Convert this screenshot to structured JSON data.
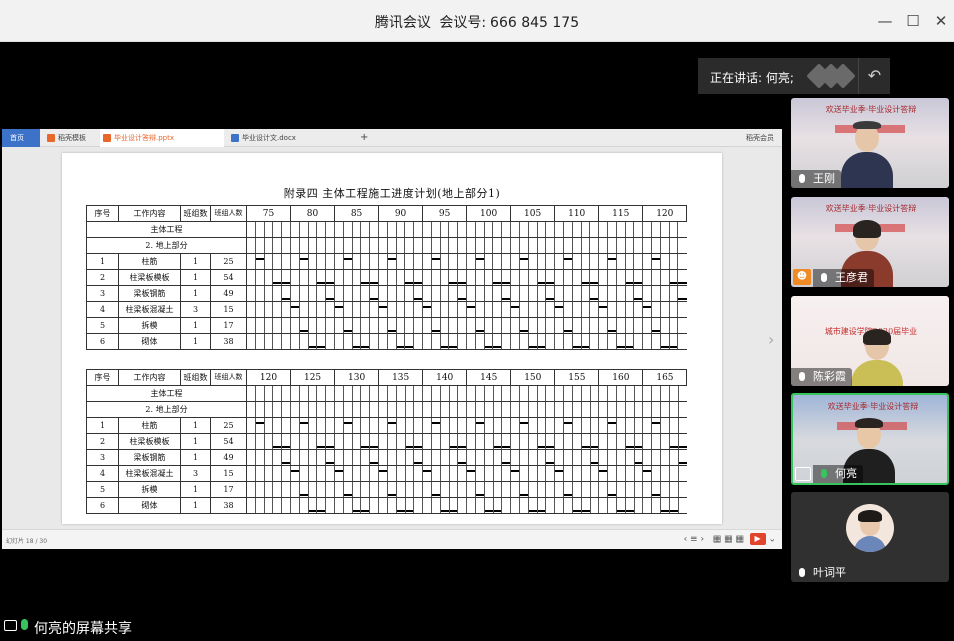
{
  "window": {
    "app_name": "腾讯会议",
    "meeting_id_label": "会议号:",
    "meeting_id": "666 845 175"
  },
  "speaking": {
    "label": "正在讲话: 何亮;"
  },
  "shared_screen": {
    "tabs": [
      {
        "label": "首页",
        "icon": "home-icon"
      },
      {
        "label": "稻壳模板",
        "icon": "docer-icon",
        "color": "#e8672c"
      },
      {
        "label": "毕业设计答辩.pptx",
        "icon": "ppt-icon",
        "color": "#e8672c"
      },
      {
        "label": "毕业设计文.docx",
        "icon": "word-icon",
        "color": "#3d72c9"
      }
    ],
    "tab_add": "+",
    "right_text": "稻壳会员",
    "status_left": "幻灯片 18 / 30",
    "document": {
      "title": "附录四  主体工程施工进度计划(地上部分1)",
      "headers": {
        "no": "序号",
        "content": "工作内容",
        "group": "班组数",
        "workers": "班组人数"
      },
      "section_main": "主体工程",
      "section_sub": "2. 地上部分",
      "rows": [
        {
          "no": "1",
          "content": "柱筋",
          "group": "1",
          "workers": "25"
        },
        {
          "no": "2",
          "content": "柱梁板模板",
          "group": "1",
          "workers": "54"
        },
        {
          "no": "3",
          "content": "梁板钢筋",
          "group": "1",
          "workers": "49"
        },
        {
          "no": "4",
          "content": "柱梁板混凝土",
          "group": "3",
          "workers": "15"
        },
        {
          "no": "5",
          "content": "拆模",
          "group": "1",
          "workers": "17"
        },
        {
          "no": "6",
          "content": "砌体",
          "group": "1",
          "workers": "38"
        }
      ],
      "table1_days": [
        "75",
        "80",
        "85",
        "90",
        "95",
        "100",
        "105",
        "110",
        "115",
        "120"
      ],
      "table2_days": [
        "120",
        "125",
        "130",
        "135",
        "140",
        "145",
        "150",
        "155",
        "160",
        "165"
      ]
    }
  },
  "participants": [
    {
      "name": "王刚",
      "banner": "欢送毕业季·毕业设计答辩"
    },
    {
      "name": "王彦君",
      "banner": "欢送毕业季·毕业设计答辩"
    },
    {
      "name": "陈彩霞",
      "banner": "城市建设学院2020届毕业答辩"
    },
    {
      "name": "何亮",
      "banner": "欢送毕业季·毕业设计答辩"
    },
    {
      "name": "叶词平"
    }
  ],
  "bottom": {
    "share_label": "何亮的屏幕共享"
  },
  "colors": {
    "active_border": "#37c45c",
    "ppt_orange": "#e8672c",
    "wps_blue": "#3d72c9"
  }
}
